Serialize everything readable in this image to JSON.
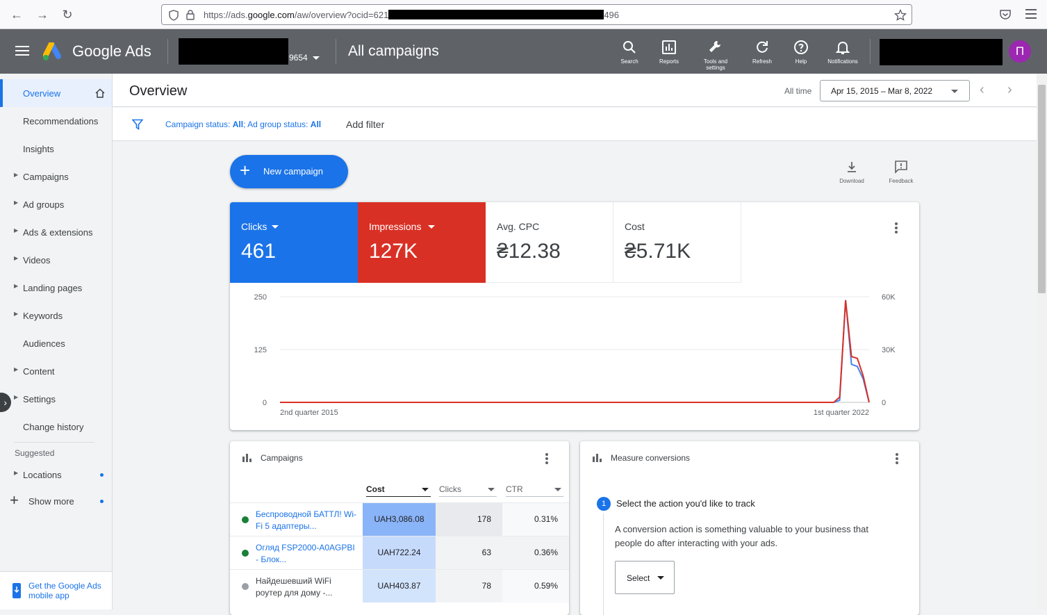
{
  "browser": {
    "url_prefix": "https://ads.",
    "url_domain": "google.com",
    "url_path": "/aw/overview?ocid=621",
    "url_suffix": "496"
  },
  "header": {
    "logo": "Google Ads",
    "account_suffix": "9654",
    "title": "All campaigns",
    "tools": [
      {
        "label": "Search",
        "icon": "search-icon"
      },
      {
        "label": "Reports",
        "icon": "reports-icon"
      },
      {
        "label": "Tools and settings",
        "icon": "wrench-icon"
      },
      {
        "label": "Refresh",
        "icon": "refresh-icon"
      },
      {
        "label": "Help",
        "icon": "help-icon"
      },
      {
        "label": "Notifications",
        "icon": "bell-icon"
      }
    ],
    "avatar_letter": "П"
  },
  "sidebar": {
    "items": [
      {
        "label": "Overview",
        "active": true
      },
      {
        "label": "Recommendations"
      },
      {
        "label": "Insights"
      },
      {
        "label": "Campaigns",
        "caret": true
      },
      {
        "label": "Ad groups",
        "caret": true
      },
      {
        "label": "Ads & extensions",
        "caret": true
      },
      {
        "label": "Videos",
        "caret": true
      },
      {
        "label": "Landing pages",
        "caret": true
      },
      {
        "label": "Keywords",
        "caret": true
      },
      {
        "label": "Audiences"
      },
      {
        "label": "Content",
        "caret": true
      },
      {
        "label": "Settings",
        "caret": true
      },
      {
        "label": "Change history"
      }
    ],
    "suggested_label": "Suggested",
    "locations_label": "Locations",
    "show_more_label": "Show more",
    "mobile_app_label": "Get the Google Ads mobile app"
  },
  "page": {
    "title": "Overview",
    "all_time_label": "All time",
    "date_range": "Apr 15, 2015 – Mar 8, 2022"
  },
  "filter": {
    "campaign_status_label": "Campaign status: ",
    "campaign_status_value": "All",
    "ad_group_status_label": "; Ad group status: ",
    "ad_group_status_value": "All",
    "add_filter": "Add filter"
  },
  "actions": {
    "new_campaign": "New campaign",
    "download": "Download",
    "feedback": "Feedback"
  },
  "metrics": [
    {
      "label": "Clicks",
      "value": "461",
      "color": "#1a73e8",
      "dropdown": true
    },
    {
      "label": "Impressions",
      "value": "127K",
      "color": "#d93025",
      "dropdown": true
    },
    {
      "label": "Avg. CPC",
      "value": "₴12.38"
    },
    {
      "label": "Cost",
      "value": "₴5.71K"
    }
  ],
  "chart_data": {
    "type": "line",
    "x_labels": [
      "2nd quarter 2015",
      "1st quarter 2022"
    ],
    "left_axis": {
      "ticks": [
        "250",
        "125",
        "0"
      ],
      "ylim": [
        0,
        250
      ]
    },
    "right_axis": {
      "ticks": [
        "60K",
        "30K",
        "0"
      ],
      "ylim": [
        0,
        60000
      ]
    },
    "series": [
      {
        "name": "Clicks",
        "color": "#4285f4",
        "axis": "left",
        "values": [
          0,
          0,
          0,
          0,
          0,
          0,
          0,
          0,
          0,
          0,
          0,
          0,
          0,
          0,
          0,
          0,
          0,
          0,
          0,
          0,
          0,
          0,
          0,
          0,
          0,
          0,
          0,
          0,
          0,
          0,
          0,
          0,
          0,
          0,
          0,
          0,
          0,
          0,
          0,
          0,
          0,
          0,
          0,
          0,
          0,
          0,
          0,
          0,
          0,
          0,
          0,
          0,
          0,
          0,
          0,
          0,
          0,
          0,
          0,
          0,
          0,
          0,
          0,
          0,
          0,
          0,
          0,
          0,
          0,
          0,
          0,
          0,
          0,
          0,
          0,
          0,
          0,
          0,
          0,
          0,
          0,
          0,
          0,
          0,
          0,
          0,
          0,
          0,
          0,
          0,
          0,
          0,
          0,
          0,
          0,
          5,
          242,
          90,
          85,
          55,
          0
        ]
      },
      {
        "name": "Impressions",
        "color": "#d93025",
        "axis": "right",
        "values": [
          0,
          0,
          0,
          0,
          0,
          0,
          0,
          0,
          0,
          0,
          0,
          0,
          0,
          0,
          0,
          0,
          0,
          0,
          0,
          0,
          0,
          0,
          0,
          0,
          0,
          0,
          0,
          0,
          0,
          0,
          0,
          0,
          0,
          0,
          0,
          0,
          0,
          0,
          0,
          0,
          0,
          0,
          0,
          0,
          0,
          0,
          0,
          0,
          0,
          0,
          0,
          0,
          0,
          0,
          0,
          0,
          0,
          0,
          0,
          0,
          0,
          0,
          0,
          0,
          0,
          0,
          0,
          0,
          0,
          0,
          0,
          0,
          0,
          0,
          0,
          0,
          0,
          0,
          0,
          0,
          0,
          0,
          0,
          0,
          0,
          0,
          0,
          0,
          0,
          0,
          0,
          0,
          0,
          0,
          0,
          3000,
          58000,
          26000,
          25000,
          15000,
          0
        ]
      }
    ]
  },
  "campaigns_card": {
    "title": "Campaigns",
    "columns": [
      "Cost",
      "Clicks",
      "CTR"
    ],
    "rows": [
      {
        "name": "Беспроводной БАТТЛ! Wi-Fi 5 адаптеры...",
        "cost": "UAH3,086.08",
        "clicks": "178",
        "ctr": "0.31%",
        "status": "active",
        "cost_shade": "#8ab4f8"
      },
      {
        "name": "Огляд FSP2000-A0AGPBI - Блок...",
        "cost": "UAH722.24",
        "clicks": "63",
        "ctr": "0.36%",
        "status": "active",
        "cost_shade": "#c6dafc"
      },
      {
        "name": "Найдешевший WiFi роутер для дому -...",
        "cost": "UAH403.87",
        "clicks": "78",
        "ctr": "0.59%",
        "status": "paused",
        "cost_shade": "#d2e3fc"
      }
    ]
  },
  "conversions_card": {
    "title": "Measure conversions",
    "step_number": "1",
    "step_title": "Select the action you'd like to track",
    "step_desc": "A conversion action is something valuable to your business that people do after interacting with your ads.",
    "select_label": "Select"
  }
}
